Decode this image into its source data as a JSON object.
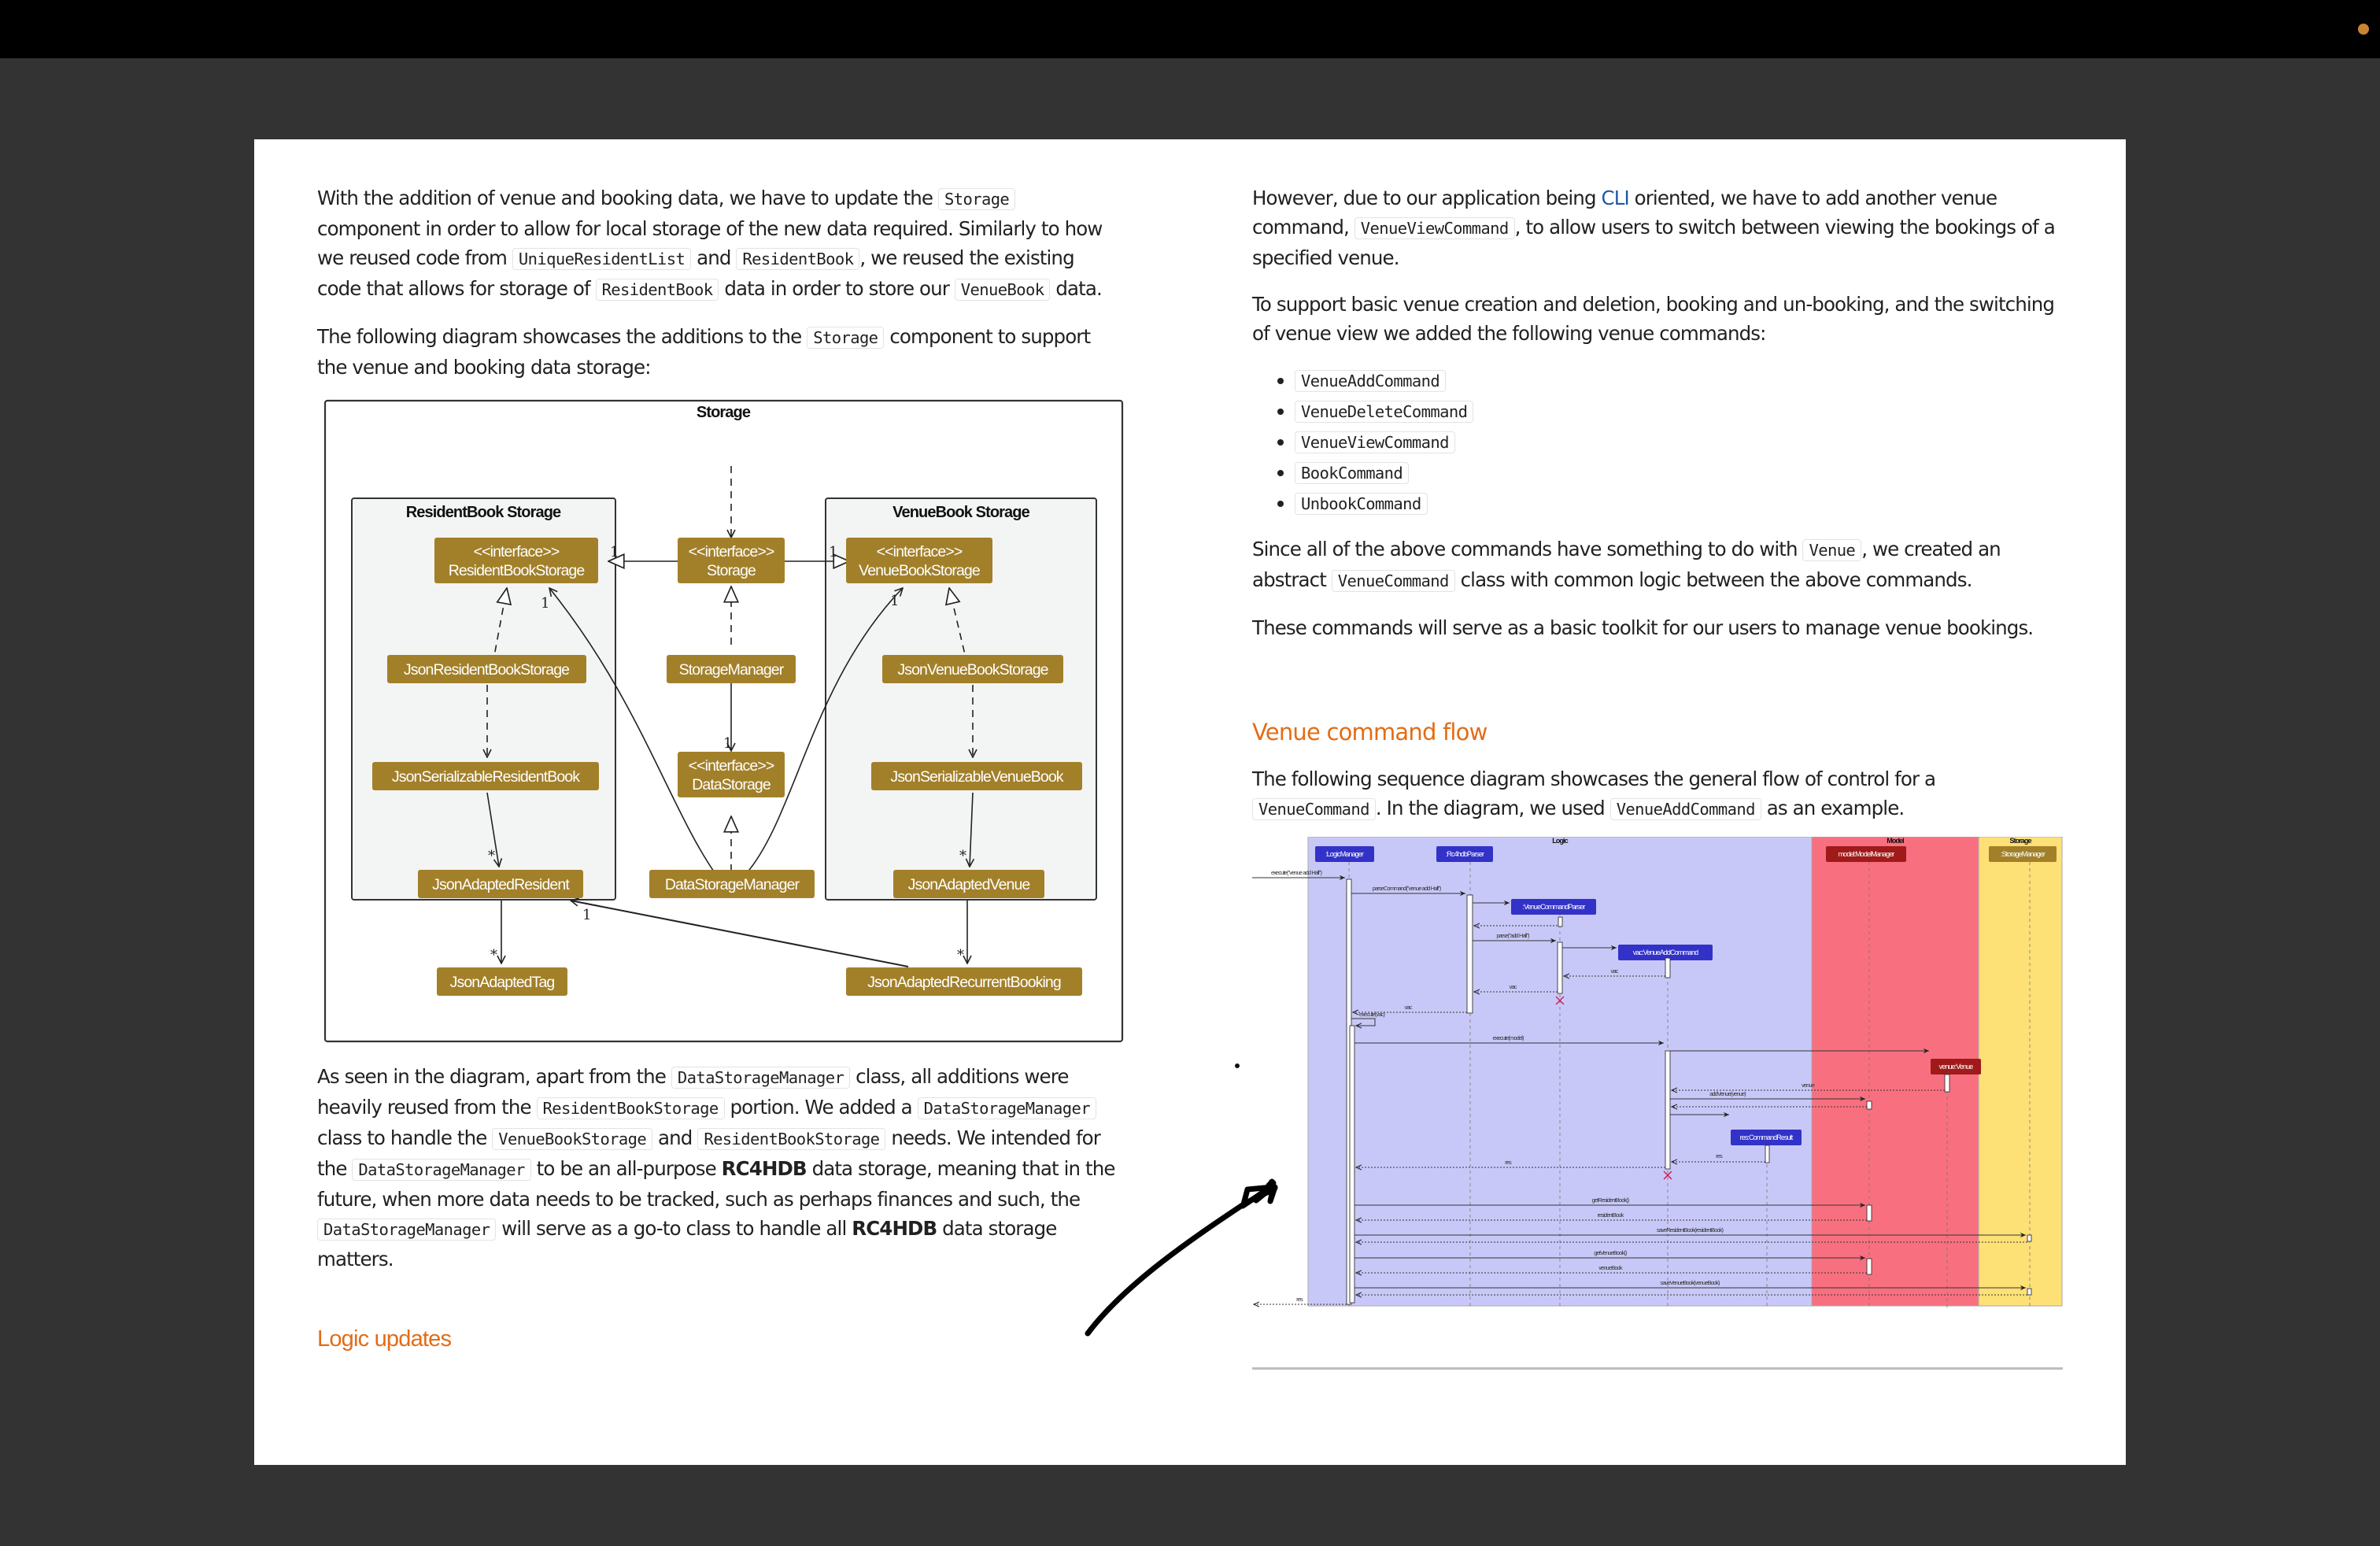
{
  "colors": {
    "heading": "#e36c16",
    "link": "#1f57a8",
    "uml_class_fill": "#a2802a",
    "uml_package_fill": "#f3f4f4",
    "logic_lane": "#c8c8f8",
    "model_lane": "#f87080",
    "storage_lane": "#fde076",
    "logic_participant": "#3232c8",
    "model_participant": "#a01a1a",
    "storage_participant": "#a2802a",
    "destroy_mark": "#c8194a",
    "recording_indicator": "#c98432"
  },
  "left": {
    "p1": {
      "t1": "With the addition of venue and booking data, we have to update the ",
      "c1": "Storage",
      "t2": " component in order to allow for local storage of the new data required. Similarly to how we reused code from ",
      "c2": "UniqueResidentList",
      "t3": " and ",
      "c3": "ResidentBook",
      "t4": ", we reused the existing code that allows for storage of ",
      "c4": "ResidentBook",
      "t5": " data in order to store our ",
      "c5": "VenueBook",
      "t6": " data."
    },
    "p2": {
      "t1": "The following diagram showcases the additions to the ",
      "c1": "Storage",
      "t2": " component to support the venue and booking data storage:"
    },
    "p3": {
      "t1": "As seen in the diagram, apart from the ",
      "c1": "DataStorageManager",
      "t2": " class, all additions were heavily reused from the ",
      "c2": "ResidentBookStorage",
      "t3": " portion. We added a ",
      "c3": "DataStorageManager",
      "t4": " class to handle the ",
      "c4": "VenueBookStorage",
      "t5": " and ",
      "c5": "ResidentBookStorage",
      "t6": " needs. We intended for the ",
      "c6": "DataStorageManager",
      "t7": " to be an all-purpose ",
      "b1": "RC4HDB",
      "t8": " data storage, meaning that in the future, when more data needs to be tracked, such as perhaps finances and such, the ",
      "c7": "DataStorageManager",
      "t9": " will serve as a go-to class to handle all ",
      "b2": "RC4HDB",
      "t10": " data storage matters."
    },
    "heading_logic": "Logic updates"
  },
  "class_diagram": {
    "title": "Storage",
    "packages": {
      "resident": "ResidentBook Storage",
      "venue": "VenueBook Storage"
    },
    "stereotype": "<<interface>>",
    "classes": {
      "resident_book_storage": "ResidentBookStorage",
      "storage": "Storage",
      "venue_book_storage": "VenueBookStorage",
      "json_resident_book_storage": "JsonResidentBookStorage",
      "storage_manager": "StorageManager",
      "json_venue_book_storage": "JsonVenueBookStorage",
      "json_serializable_resident_book": "JsonSerializableResidentBook",
      "data_storage": "DataStorage",
      "json_serializable_venue_book": "JsonSerializableVenueBook",
      "json_adapted_resident": "JsonAdaptedResident",
      "data_storage_manager": "DataStorageManager",
      "json_adapted_venue": "JsonAdaptedVenue",
      "json_adapted_tag": "JsonAdaptedTag",
      "json_adapted_recurrent_booking": "JsonAdaptedRecurrentBooking"
    },
    "multiplicities": {
      "one": "1",
      "many": "*"
    }
  },
  "right": {
    "p1": {
      "t1": "However, due to our application being ",
      "link": "CLI",
      "t2": " oriented, we have to add another venue command, ",
      "c1": "VenueViewCommand",
      "t3": ", to allow users to switch between viewing the bookings of a specified venue."
    },
    "p2": "To support basic venue creation and deletion, booking and un-booking, and the switching of venue view we added the following venue commands:",
    "commands": [
      "VenueAddCommand",
      "VenueDeleteCommand",
      "VenueViewCommand",
      "BookCommand",
      "UnbookCommand"
    ],
    "p3": {
      "t1": "Since all of the above commands have something to do with ",
      "c1": "Venue",
      "t2": ", we created an abstract ",
      "c2": "VenueCommand",
      "t3": " class with common logic between the above commands."
    },
    "p4": "These commands will serve as a basic toolkit for our users to manage venue bookings.",
    "heading_flow": "Venue command flow",
    "p5": {
      "t1": "The following sequence diagram showcases the general flow of control for a ",
      "c1": "VenueCommand",
      "t2": ". In the diagram, we used ",
      "c2": "VenueAddCommand",
      "t3": " as an example."
    }
  },
  "sequence_diagram": {
    "lanes": {
      "logic": "Logic",
      "model": "Model",
      "storage": "Storage"
    },
    "participants": {
      "logic_manager": ":LogicManager",
      "parser": ":Rc4hdbParser",
      "venue_command_parser": ":VenueCommandParser",
      "vac": "vac:VenueAddCommand",
      "result": "res:CommandResult",
      "model_manager": "model:ModelManager",
      "venue": "venue:Venue",
      "storage_manager": ":StorageManager"
    },
    "messages": {
      "m1": "execute(\"venue add Hall\")",
      "m2": "parseCommand(\"venue add Hall\")",
      "m3": "parse(\"add Hall\")",
      "m4": "vac",
      "m5": "vac",
      "m6": "vac",
      "m7": "execute(vac)",
      "m8": "execute(model)",
      "m9": "venue",
      "m10": "addVenue(venue)",
      "m11": "res",
      "m12": "res",
      "m13": "getResidentBook()",
      "m14": "residentBook",
      "m15": "saveResidentBook(residentBook)",
      "m16": "getVenueBook()",
      "m17": "venueBook",
      "m18": "saveVenueBook(venueBook)",
      "m19": "res"
    }
  }
}
